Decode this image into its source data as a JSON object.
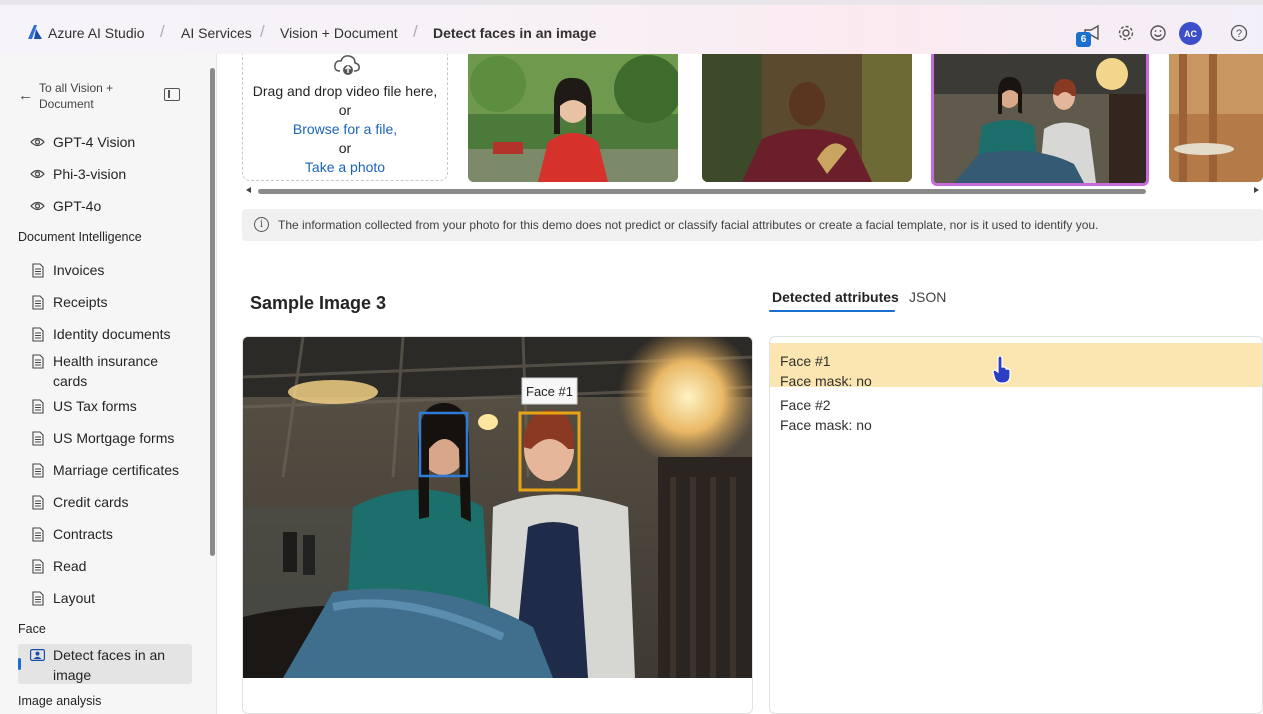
{
  "header": {
    "app_title": "Azure AI Studio",
    "breadcrumbs": [
      "AI Services",
      "Vision + Document",
      "Detect faces in an image"
    ],
    "notification_count": "6",
    "avatar_initials": "AC"
  },
  "sidebar": {
    "back_label": "To all Vision + Document",
    "top_items": [
      "GPT-4 Vision",
      "Phi-3-vision",
      "GPT-4o"
    ],
    "sections": {
      "document_intelligence": "Document Intelligence",
      "face": "Face",
      "image_analysis": "Image analysis"
    },
    "document_items": [
      "Invoices",
      "Receipts",
      "Identity documents",
      "Health insurance cards",
      "US Tax forms",
      "US Mortgage forms",
      "Marriage certificates",
      "Credit cards",
      "Contracts",
      "Read",
      "Layout"
    ],
    "face_items": [
      "Detect faces in an image"
    ]
  },
  "upload": {
    "drag_text": "Drag and drop video file here,",
    "or1": "or",
    "browse_link": "Browse for a file,",
    "or2": "or",
    "photo_link": "Take a photo"
  },
  "info_notice": "The information collected from your photo for this demo does not predict or classify facial attributes or create a facial template, nor is it used to identify you.",
  "sample": {
    "title": "Sample Image 3",
    "face_box_label": "Face #1"
  },
  "tabs": [
    "Detected attributes",
    "JSON"
  ],
  "faces": [
    {
      "name": "Face #1",
      "mask": "Face mask: no"
    },
    {
      "name": "Face #2",
      "mask": "Face mask: no"
    }
  ],
  "colors": {
    "accent": "#1a6fcf",
    "highlight": "#fbe6b2",
    "face1_box": "#e8a317",
    "face2_box": "#2f7bd6",
    "selected_thumb_border": "#c66bd9"
  }
}
